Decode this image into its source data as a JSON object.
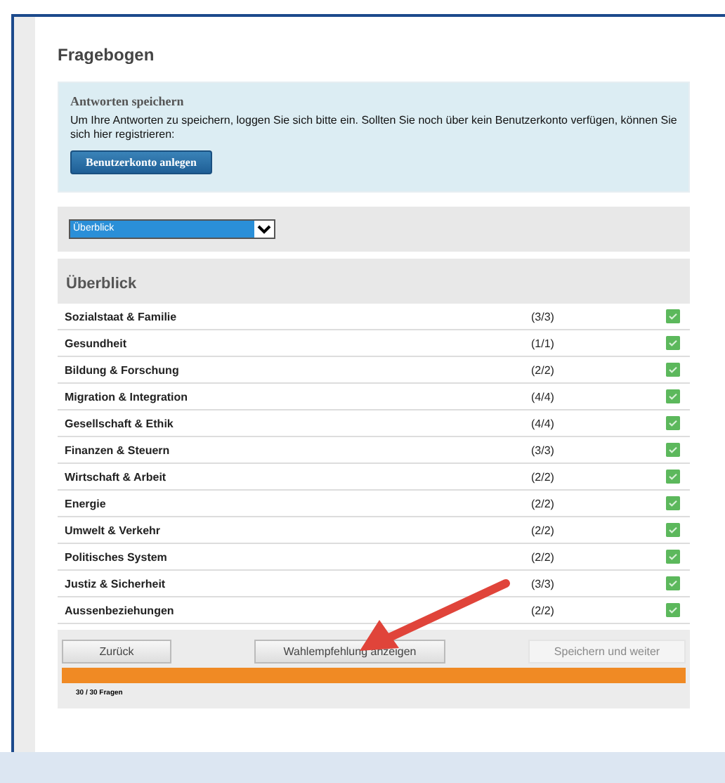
{
  "title": "Fragebogen",
  "save_box": {
    "heading": "Antworten speichern",
    "text": "Um Ihre Antworten zu speichern, loggen Sie sich bitte ein. Sollten Sie noch über kein Benutzerkonto verfügen, können Sie sich hier registrieren:",
    "button": "Benutzerkonto anlegen"
  },
  "select": {
    "value": "Überblick"
  },
  "overview": {
    "heading": "Überblick",
    "rows": [
      {
        "name": "Sozialstaat & Familie",
        "count": "(3/3)",
        "done": true
      },
      {
        "name": "Gesundheit",
        "count": "(1/1)",
        "done": true
      },
      {
        "name": "Bildung & Forschung",
        "count": "(2/2)",
        "done": true
      },
      {
        "name": "Migration & Integration",
        "count": "(4/4)",
        "done": true
      },
      {
        "name": "Gesellschaft & Ethik",
        "count": "(4/4)",
        "done": true
      },
      {
        "name": "Finanzen & Steuern",
        "count": "(3/3)",
        "done": true
      },
      {
        "name": "Wirtschaft & Arbeit",
        "count": "(2/2)",
        "done": true
      },
      {
        "name": "Energie",
        "count": "(2/2)",
        "done": true
      },
      {
        "name": "Umwelt & Verkehr",
        "count": "(2/2)",
        "done": true
      },
      {
        "name": "Politisches System",
        "count": "(2/2)",
        "done": true
      },
      {
        "name": "Justiz & Sicherheit",
        "count": "(3/3)",
        "done": true
      },
      {
        "name": "Aussenbeziehungen",
        "count": "(2/2)",
        "done": true
      }
    ]
  },
  "buttons": [
    {
      "label": "Zurück",
      "disabled": false
    },
    {
      "label": "Wahlempfehlung anzeigen",
      "disabled": false
    },
    {
      "label": "Speichern und weiter",
      "disabled": true
    }
  ],
  "progress": {
    "level": 1,
    "label": "30 / 30 Fragen"
  }
}
